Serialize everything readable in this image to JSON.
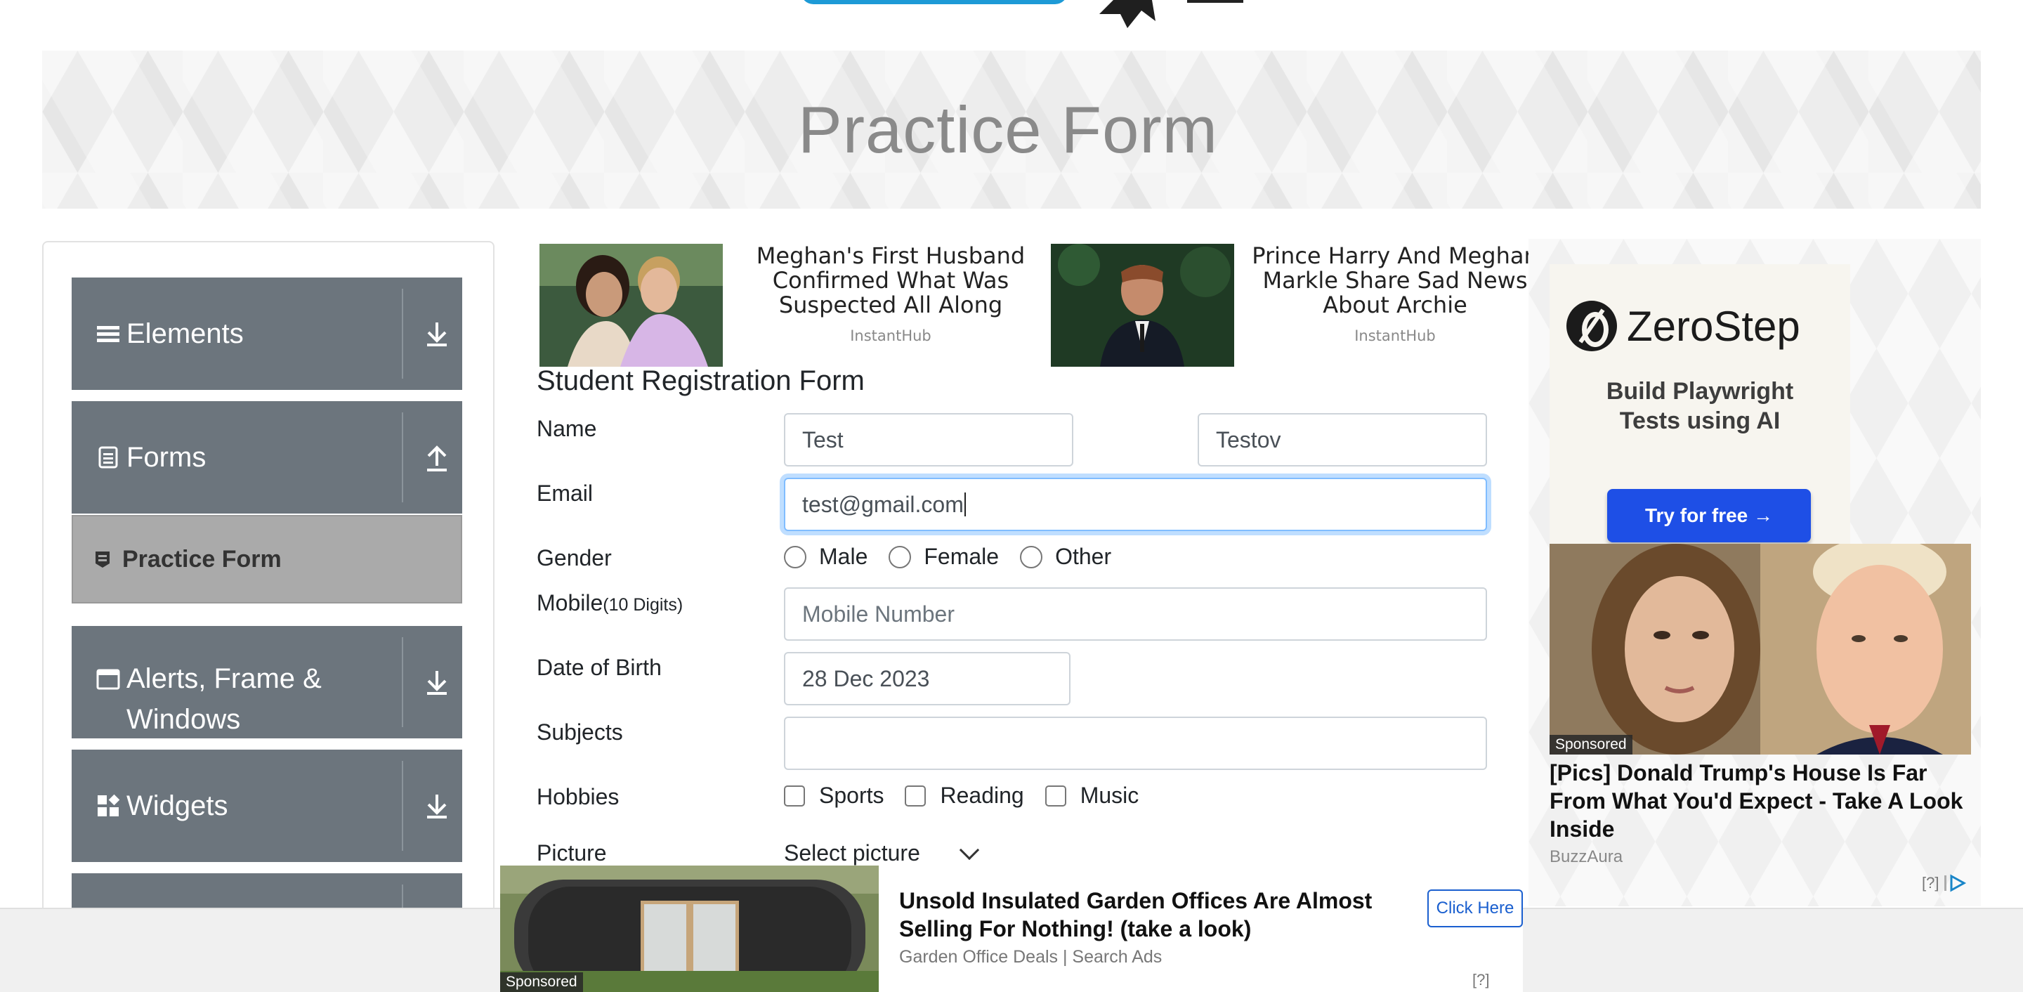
{
  "banner": {
    "title": "Practice Form"
  },
  "sidebar": {
    "groups": [
      {
        "label": "Elements",
        "icon": "hamburger-icon"
      },
      {
        "label": "Forms",
        "icon": "document-icon"
      },
      {
        "label": "Alerts, Frame &",
        "label2": "Windows",
        "icon": "window-icon"
      },
      {
        "label": "Widgets",
        "icon": "widgets-icon"
      }
    ],
    "active_item": "Practice Form"
  },
  "top_ads": [
    {
      "headline": "Meghan's First Husband Confirmed What Was Suspected All Along",
      "source": "InstantHub"
    },
    {
      "headline": "Prince Harry And Meghan Markle Share Sad News About Archie",
      "source": "InstantHub"
    }
  ],
  "form": {
    "title": "Student Registration Form",
    "name": {
      "label": "Name",
      "first": "Test",
      "last": "Testov"
    },
    "email": {
      "label": "Email",
      "value": "test@gmail.com"
    },
    "gender": {
      "label": "Gender",
      "options": [
        "Male",
        "Female",
        "Other"
      ]
    },
    "mobile": {
      "label": "Mobile",
      "hint": "(10 Digits)",
      "placeholder": "Mobile Number"
    },
    "dob": {
      "label": "Date of Birth",
      "value": "28 Dec 2023"
    },
    "subjects": {
      "label": "Subjects",
      "value": ""
    },
    "hobbies": {
      "label": "Hobbies",
      "options": [
        "Sports",
        "Reading",
        "Music"
      ]
    },
    "picture": {
      "label": "Picture",
      "value": "Select picture"
    }
  },
  "right_ad": {
    "brand": "ZeroStep",
    "tagline_1": "Build Playwright",
    "tagline_2": "Tests using AI",
    "cta": "Try for free →",
    "badge": "Sponsored",
    "headline": "[Pics] Donald Trump's House Is Far From What You'd Expect - Take A Look Inside",
    "source": "BuzzAura",
    "marker": "[?]"
  },
  "bottom_ad": {
    "headline": "Unsold Insulated Garden Offices Are Almost Selling For Nothing! (take a look)",
    "source": "Garden Office Deals | Search Ads",
    "button": "Click Here",
    "badge": "Sponsored",
    "marker": "[?]"
  },
  "colors": {
    "sidebar_group": "#6c757d",
    "active_item": "#aaaaaa",
    "focus_border": "#80bdff",
    "cta_blue": "#1e4fe6"
  }
}
